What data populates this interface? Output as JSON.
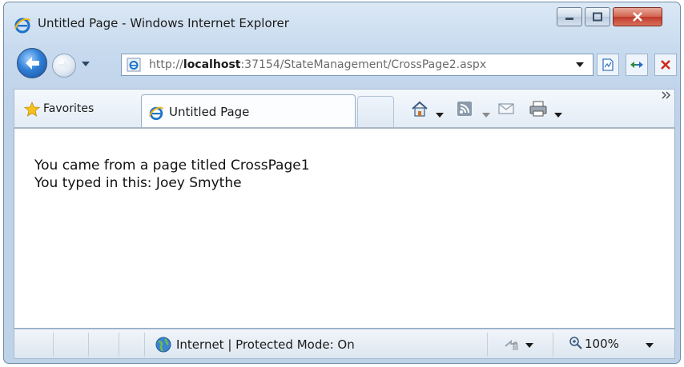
{
  "window": {
    "title": "Untitled Page - Windows Internet Explorer"
  },
  "address_bar": {
    "url_prefix": "http://",
    "url_host": "localhost",
    "url_rest": ":37154/StateManagement/CrossPage2.aspx"
  },
  "favorites": {
    "label": "Favorites"
  },
  "tab": {
    "label": "Untitled Page"
  },
  "page": {
    "lines": [
      "You came from a page titled CrossPage1",
      "You typed in this: Joey Smythe"
    ]
  },
  "status_bar": {
    "zone": "Internet | Protected Mode: On",
    "zoom": "100%"
  },
  "icons": {
    "app": "ie-logo-icon",
    "back": "back-arrow-icon",
    "forward": "forward-arrow-icon",
    "compat": "compatibility-view-icon",
    "refresh": "refresh-icon",
    "stop": "stop-icon",
    "home": "home-icon",
    "feeds": "feeds-icon",
    "mail": "read-mail-icon",
    "print": "print-icon",
    "globe": "globe-icon",
    "zoom": "zoom-icon"
  },
  "colors": {
    "chrome": "#c7daee",
    "close_button": "#c0392b",
    "back_button": "#2f7fd6"
  }
}
